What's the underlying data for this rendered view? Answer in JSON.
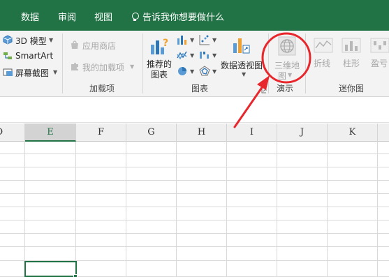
{
  "tabs": [
    "数据",
    "审阅",
    "视图"
  ],
  "tell_me": "告诉我你想要做什么",
  "ribbon": {
    "model3d": "3D 模型",
    "smartart": "SmartArt",
    "screenshot": "屏幕截图",
    "app_store": "应用商店",
    "my_addins": "我的加载项",
    "addins_group": "加载项",
    "recommended_charts_line1": "推荐的",
    "recommended_charts_line2": "图表",
    "charts_group": "图表",
    "pivot_chart": "数据透视图",
    "map3d_line1": "三维地",
    "map3d_line2": "图",
    "tours_group": "演示",
    "sparkline_line": "折线",
    "sparkline_column": "柱形",
    "sparkline_winloss": "盈亏",
    "sparklines_group": "迷你图"
  },
  "columns": [
    "D",
    "E",
    "F",
    "G",
    "H",
    "I",
    "J",
    "K"
  ],
  "selected_column": "E",
  "colors": {
    "brand": "#217346",
    "annotation": "#e8272d"
  }
}
